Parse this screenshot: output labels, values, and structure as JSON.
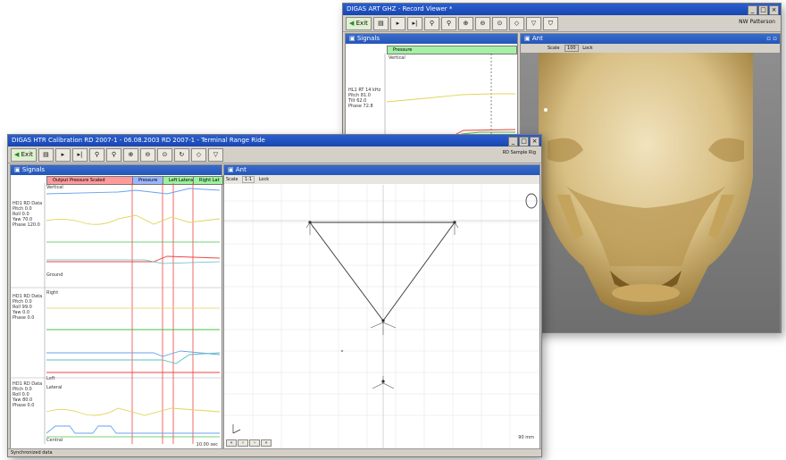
{
  "window_back": {
    "title": "DIGAS ART GHZ - Record Viewer *",
    "controls": [
      "_",
      "□",
      "×"
    ],
    "toolbar_exit": "Exit",
    "toolbar_right": "NW Patterson",
    "signals_panel": "Signals",
    "signals_chip": "Pressure",
    "signals_chip_sub": "Vertical",
    "stats": [
      "HL1 RT 14 kHz",
      "Pitch 81.0",
      "Tilt 62.0",
      "Phase 72.8"
    ],
    "view_panel": "Ant",
    "view_tabs": [
      "Scale",
      "100",
      "Lock"
    ]
  },
  "window_front": {
    "title": "DIGAS HTR Calibration   RD 2007-1 - 06.08.2003   RD 2007-1 - Terminal Range Ride",
    "controls": [
      "_",
      "□",
      "×"
    ],
    "toolbar_exit": "Exit",
    "toolbar_right": "RD Sample Rig",
    "signals_panel": "Signals",
    "chips": [
      {
        "label": "Output Pressure Scaled",
        "color": "#ff9a9a"
      },
      {
        "label": "Pressure",
        "color": "#9ab6ff"
      },
      {
        "label": "Left Lateral",
        "color": "#9cf29c"
      },
      {
        "label": "Right Lat",
        "color": "#9cf29c"
      }
    ],
    "chart_labels": [
      "Vertical",
      "Right",
      "Lateral",
      "Ground",
      "Left",
      "Central"
    ],
    "stats1": [
      "HD1 RD Data",
      "Pitch 0.0",
      "Roll 0.0",
      "Yaw 70.0",
      "Phase 120.0"
    ],
    "stats2": [
      "HD1 RD Data",
      "Pitch 0.0",
      "Roll 99.0",
      "Yaw 0.0",
      "Phase 0.0"
    ],
    "stats3": [
      "HD1 RD Data",
      "Pitch 0.0",
      "Roll 0.0",
      "Yaw 80.0",
      "Phase 0.0"
    ],
    "time_label": "10.00 sec",
    "view_panel": "Ant",
    "view_tabs": [
      "Scale",
      "1:1",
      "Lock"
    ],
    "view_corner": "90 mm",
    "status": "Synchronized data"
  },
  "colors": {
    "yellow": "#e4d25a",
    "blue": "#6aa2f0",
    "green": "#46c046",
    "red": "#ee4444",
    "teal": "#5ac0c0",
    "titlebar": "#1846b0"
  }
}
